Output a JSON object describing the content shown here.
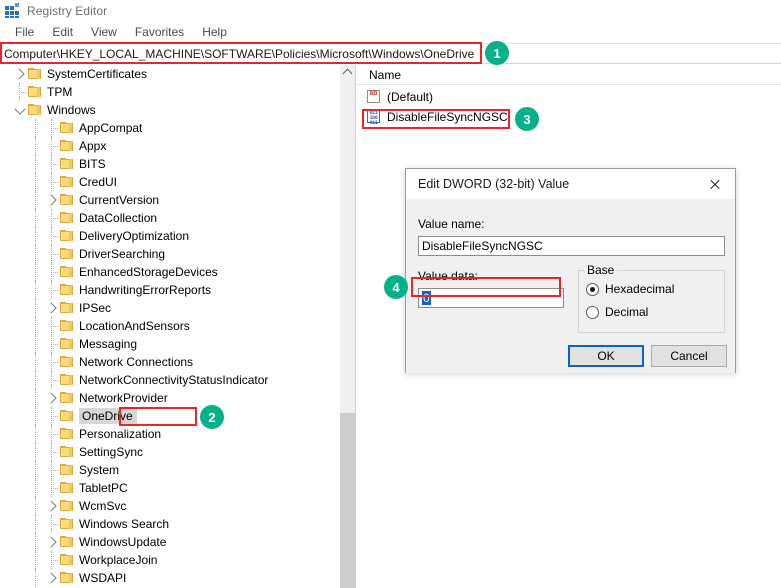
{
  "window": {
    "title": "Registry Editor",
    "icon": "registry-grid-icon"
  },
  "menu": {
    "items": [
      "File",
      "Edit",
      "View",
      "Favorites",
      "Help"
    ]
  },
  "address": {
    "path": "Computer\\HKEY_LOCAL_MACHINE\\SOFTWARE\\Policies\\Microsoft\\Windows\\OneDrive"
  },
  "tree": {
    "items": [
      {
        "label": "SystemCertificates",
        "depth": 1,
        "twist": "right",
        "selected": false
      },
      {
        "label": "TPM",
        "depth": 1,
        "twist": "none",
        "selected": false
      },
      {
        "label": "Windows",
        "depth": 1,
        "twist": "down",
        "selected": false
      },
      {
        "label": "AppCompat",
        "depth": 2,
        "twist": "none",
        "selected": false
      },
      {
        "label": "Appx",
        "depth": 2,
        "twist": "none",
        "selected": false
      },
      {
        "label": "BITS",
        "depth": 2,
        "twist": "none",
        "selected": false
      },
      {
        "label": "CredUI",
        "depth": 2,
        "twist": "none",
        "selected": false
      },
      {
        "label": "CurrentVersion",
        "depth": 2,
        "twist": "right",
        "selected": false
      },
      {
        "label": "DataCollection",
        "depth": 2,
        "twist": "none",
        "selected": false
      },
      {
        "label": "DeliveryOptimization",
        "depth": 2,
        "twist": "none",
        "selected": false
      },
      {
        "label": "DriverSearching",
        "depth": 2,
        "twist": "none",
        "selected": false
      },
      {
        "label": "EnhancedStorageDevices",
        "depth": 2,
        "twist": "none",
        "selected": false
      },
      {
        "label": "HandwritingErrorReports",
        "depth": 2,
        "twist": "none",
        "selected": false
      },
      {
        "label": "IPSec",
        "depth": 2,
        "twist": "right",
        "selected": false
      },
      {
        "label": "LocationAndSensors",
        "depth": 2,
        "twist": "none",
        "selected": false
      },
      {
        "label": "Messaging",
        "depth": 2,
        "twist": "none",
        "selected": false
      },
      {
        "label": "Network Connections",
        "depth": 2,
        "twist": "none",
        "selected": false
      },
      {
        "label": "NetworkConnectivityStatusIndicator",
        "depth": 2,
        "twist": "none",
        "selected": false
      },
      {
        "label": "NetworkProvider",
        "depth": 2,
        "twist": "right",
        "selected": false
      },
      {
        "label": "OneDrive",
        "depth": 2,
        "twist": "none",
        "selected": true
      },
      {
        "label": "Personalization",
        "depth": 2,
        "twist": "none",
        "selected": false
      },
      {
        "label": "SettingSync",
        "depth": 2,
        "twist": "none",
        "selected": false
      },
      {
        "label": "System",
        "depth": 2,
        "twist": "none",
        "selected": false
      },
      {
        "label": "TabletPC",
        "depth": 2,
        "twist": "none",
        "selected": false
      },
      {
        "label": "WcmSvc",
        "depth": 2,
        "twist": "right",
        "selected": false
      },
      {
        "label": "Windows Search",
        "depth": 2,
        "twist": "none",
        "selected": false
      },
      {
        "label": "WindowsUpdate",
        "depth": 2,
        "twist": "right",
        "selected": false
      },
      {
        "label": "WorkplaceJoin",
        "depth": 2,
        "twist": "none",
        "selected": false
      },
      {
        "label": "WSDAPI",
        "depth": 2,
        "twist": "right",
        "selected": false
      }
    ]
  },
  "values": {
    "header": "Name",
    "rows": [
      {
        "name": "(Default)",
        "icon": "string-value-icon"
      },
      {
        "name": "DisableFileSyncNGSC",
        "icon": "dword-value-icon"
      }
    ]
  },
  "dialog": {
    "title": "Edit DWORD (32-bit) Value",
    "close_label": "✕",
    "value_name_label": "Value name:",
    "value_name": "DisableFileSyncNGSC",
    "value_data_label": "Value data:",
    "value_data": "0",
    "base_legend": "Base",
    "base_options": [
      "Hexadecimal",
      "Decimal"
    ],
    "base_selected": "Hexadecimal",
    "ok_label": "OK",
    "cancel_label": "Cancel"
  },
  "markers": [
    {
      "n": "1"
    },
    {
      "n": "2"
    },
    {
      "n": "3"
    },
    {
      "n": "4"
    }
  ],
  "colors": {
    "marker": "#06b189",
    "highlight": "#e8262a",
    "selection": "#0a64c8"
  }
}
